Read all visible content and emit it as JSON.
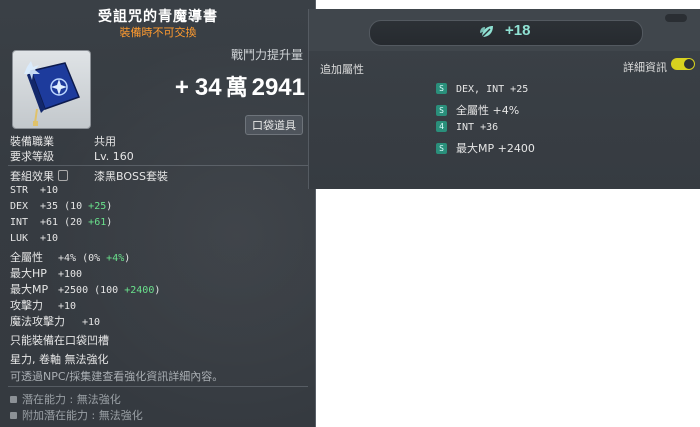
{
  "item": {
    "title": "受詛咒的青魔導書",
    "subtitle": "裝備時不可交換",
    "power_label": "戰鬥力提升量",
    "power_plus": "+",
    "power_part1": "34",
    "power_wan": "萬",
    "power_part2": "2941",
    "pocket_badge": "口袋道具",
    "req": [
      {
        "k": "裝備職業",
        "v": "共用"
      },
      {
        "k": "要求等級",
        "v": "Lv. 160"
      }
    ],
    "set_label": "套組效果",
    "set_name": "漆黑BOSS套裝",
    "stats": [
      {
        "k": "STR",
        "v": "+10",
        "g": ""
      },
      {
        "k": "DEX",
        "v": "+35 (10 ",
        "g": "+25",
        "tail": ")"
      },
      {
        "k": "INT",
        "v": "+61 (20 ",
        "g": "+61",
        "tail": ")"
      },
      {
        "k": "LUK",
        "v": "+10",
        "g": ""
      },
      {
        "k": "全屬性",
        "v": "+4% (0% ",
        "g": "+4%",
        "tail": ")"
      },
      {
        "k": "最大HP",
        "v": "+100",
        "g": ""
      },
      {
        "k": "最大MP",
        "v": "+2500 (100 ",
        "g": "+2400",
        "tail": ")"
      },
      {
        "k": "攻擊力",
        "v": "+10",
        "g": ""
      },
      {
        "k": "魔法攻擊力",
        "v": "+10",
        "g": ""
      }
    ],
    "note1": "只能裝備在口袋凹槽",
    "note2": "星力, 卷軸 無法強化",
    "note3": "可透過NPC/採集建查看強化資訊詳細內容。",
    "potential": "潛在能力 : 無法強化",
    "additional_potential": "附加潛在能力 : 無法強化"
  },
  "panel": {
    "value": "+18",
    "add_label": "追加屬性",
    "detail_label": "詳細資訊",
    "detail_toggle_on": true,
    "rows": [
      {
        "tier": "S",
        "tier_color": "#2a8f7b",
        "text": "DEX, INT  +25"
      },
      {
        "tier": "S",
        "tier_color": "#2a8f7b",
        "text": "全屬性  +4%"
      },
      {
        "tier": "4",
        "tier_color": "#2a8f7b",
        "text": "INT  +36"
      },
      {
        "tier": "S",
        "tier_color": "#2a8f7b",
        "text": "最大MP  +2400"
      }
    ],
    "colors": {
      "accent": "#8fe1d3",
      "toggle": "#d8d21f",
      "green_stat": "#67e08a",
      "orange": "#ff9b2f"
    }
  }
}
